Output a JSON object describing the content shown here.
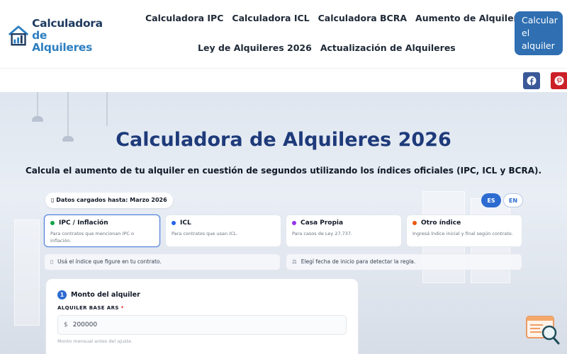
{
  "brand": {
    "line1": "Calculadora",
    "line2": "de Alquileres",
    "primary_color": "#1e3a5f",
    "accent_color": "#2d7fc1"
  },
  "nav": {
    "row1": [
      "Calculadora IPC",
      "Calculadora ICL",
      "Calculadora BCRA",
      "Aumento de Alquiler"
    ],
    "row2": [
      "Ley de Alquileres 2026",
      "Actualización de Alquileres"
    ]
  },
  "cta": {
    "line1": "Calcular",
    "line2": "el",
    "line3": "alquiler"
  },
  "social": {
    "facebook_icon": "facebook-icon",
    "pinterest_icon": "pinterest-icon"
  },
  "hero": {
    "title": "Calculadora de Alquileres 2026",
    "subtitle": "Calcula el aumento de tu alquiler en cuestión de segundos utilizando los índices oficiales (IPC, ICL y BCRA)."
  },
  "status": {
    "data_loaded": "Datos cargados hasta: Marzo 2026"
  },
  "language": {
    "es": "ES",
    "en": "EN",
    "selected": "ES"
  },
  "index_cards": [
    {
      "title": "IPC / Inflación",
      "description": "Para contratos que mencionan IPC o inflación.",
      "dot_color": "#16a34a",
      "active": true
    },
    {
      "title": "ICL",
      "description": "Para contratos que usan ICL.",
      "dot_color": "#2563eb",
      "active": false
    },
    {
      "title": "Casa Propia",
      "description": "Para casos de Ley 27.737.",
      "dot_color": "#9333ea",
      "active": false
    },
    {
      "title": "Otro índice",
      "description": "Ingresá índice inicial y final según contrato.",
      "dot_color": "#ea580c",
      "active": false
    }
  ],
  "hints": {
    "left": "Usá el índice que figure en tu contrato.",
    "right": "Elegí fecha de inicio para detectar la regla."
  },
  "form": {
    "step_number": "1",
    "step_title": "Monto del alquiler",
    "field_label": "ALQUILER BASE ARS",
    "required_mark": "*",
    "currency_prefix": "$",
    "amount_value": "200000",
    "help_text": "Monto mensual antes del ajuste."
  }
}
